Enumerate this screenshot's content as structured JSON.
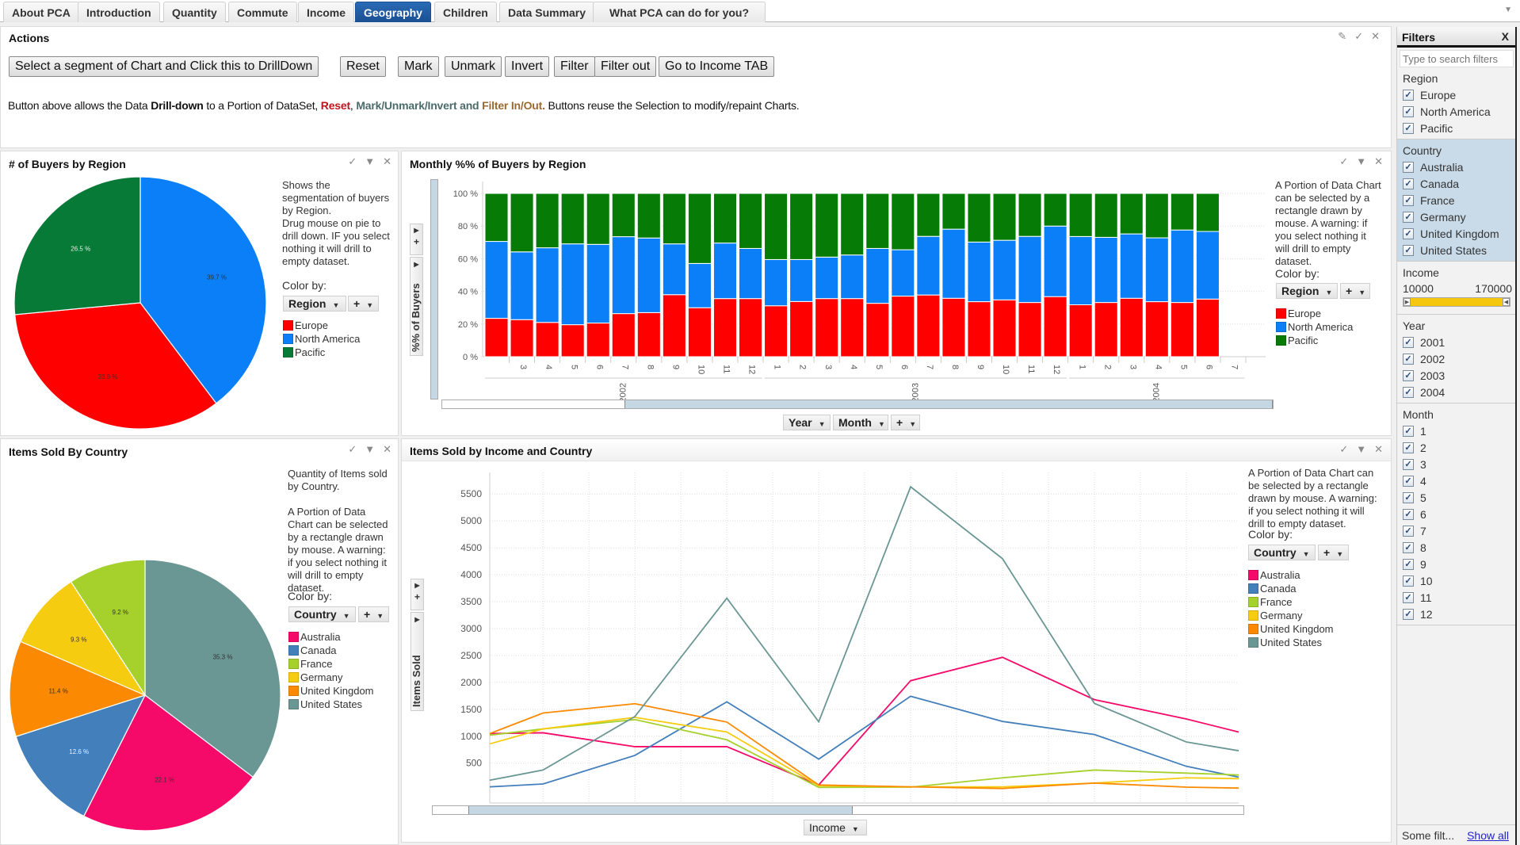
{
  "tabs": [
    {
      "label": "About PCA",
      "active": false
    },
    {
      "label": "Introduction",
      "active": false
    },
    {
      "label": "Quantity",
      "active": false
    },
    {
      "label": "Commute",
      "active": false
    },
    {
      "label": "Income",
      "active": false
    },
    {
      "label": "Geography",
      "active": true
    },
    {
      "label": "Children",
      "active": false
    },
    {
      "label": "Data Summary",
      "active": false
    },
    {
      "label": "What PCA can do for you?",
      "active": false
    }
  ],
  "actions": {
    "title": "Actions",
    "buttons": [
      "Select a segment of Chart and Click this to DrillDown",
      "Reset",
      "Mark",
      "Unmark",
      "Invert",
      "Filter",
      "Filter out",
      "Go to Income TAB"
    ],
    "description": {
      "p1": "Button above allows the Data ",
      "b1": "Drill-down",
      "p2": " to a Portion of DataSet, ",
      "reset": "Reset",
      "p3": ", ",
      "mark": "Mark/Unmark/Invert and",
      "p4": " ",
      "filter": "Filter In/Out.",
      "p5": " Buttons reuse the Selection to modify/repaint Charts."
    }
  },
  "colors": {
    "region": {
      "Europe": "#ff0000",
      "North America": "#0a7ff7",
      "Pacific": "#087a38"
    },
    "country": {
      "Australia": "#f50a6a",
      "Canada": "#437fbb",
      "France": "#a6d12d",
      "Germany": "#f6cc10",
      "United Kingdom": "#fb8a02",
      "United States": "#6a9694"
    },
    "bar_pacific": "#067b06"
  },
  "buyers_panel": {
    "title": "# of Buyers by Region",
    "help": "Shows the\nsegmentation of buyers\nby Region.\nDrug mouse on pie to\ndrill down. IF you select\nnothing it will drill to\nempty dataset.",
    "color_by_label": "Color by:",
    "color_by_value": "Region",
    "plus_label": "+"
  },
  "monthly_panel": {
    "title": "Monthly %% of Buyers by Region",
    "help": "A Portion of Data Chart\ncan be selected by a\nrectangle drawn by\nmouse. A warning: if\nyou select nothing it\nwill drill to empty\ndataset.",
    "color_by_label": "Color by:",
    "color_by_value": "Region",
    "plus_label": "+",
    "axis_ctrl_label": "%% of Buyers",
    "x_buttons": [
      "Year",
      "Month",
      "+"
    ]
  },
  "country_panel": {
    "title": "Items Sold By Country",
    "help": "Quantity of Items sold\nby Country.\n\nA Portion of Data\nChart can be selected\nby a rectangle drawn\nby mouse. A warning:\nif you select nothing it\nwill drill to empty\ndataset.",
    "color_by_label": "Color by:",
    "color_by_value": "Country",
    "plus_label": "+"
  },
  "income_panel": {
    "title": "Items Sold by Income and Country",
    "help": "A Portion of Data Chart can\nbe selected by a rectangle\ndrawn by mouse. A warning:\nif you select nothing it will\ndrill to empty dataset.",
    "color_by_label": "Color by:",
    "color_by_value": "Country",
    "plus_label": "+",
    "axis_ctrl_label": "Items Sold",
    "x_button": "Income"
  },
  "chart_data": [
    {
      "id": "buyers_by_region",
      "type": "pie",
      "title": "# of Buyers by Region",
      "legend_title": "Region",
      "slices": [
        {
          "label": "North America",
          "value": 39.7,
          "display": "39.7 %"
        },
        {
          "label": "Europe",
          "value": 33.8,
          "display": "33.8 %"
        },
        {
          "label": "Pacific",
          "value": 26.5,
          "display": "26.5 %"
        }
      ],
      "legend": [
        "Europe",
        "North America",
        "Pacific"
      ]
    },
    {
      "id": "monthly_buyers_by_region",
      "type": "bar",
      "stacked": true,
      "title": "Monthly %% of Buyers by Region",
      "ylabel": "%% of Buyers",
      "xlabel": "Year / Month",
      "ylim": [
        0,
        100
      ],
      "yticks": [
        "0 %",
        "20 %",
        "40 %",
        "60 %",
        "80 %",
        "100 %"
      ],
      "categories": [
        {
          "year": "2002",
          "month": ""
        },
        {
          "year": "2002",
          "month": "3"
        },
        {
          "year": "2002",
          "month": "4"
        },
        {
          "year": "2002",
          "month": "5"
        },
        {
          "year": "2002",
          "month": "6"
        },
        {
          "year": "2002",
          "month": "7"
        },
        {
          "year": "2002",
          "month": "8"
        },
        {
          "year": "2002",
          "month": "9"
        },
        {
          "year": "2002",
          "month": "10"
        },
        {
          "year": "2002",
          "month": "11"
        },
        {
          "year": "2002",
          "month": "12"
        },
        {
          "year": "2003",
          "month": "1"
        },
        {
          "year": "2003",
          "month": "2"
        },
        {
          "year": "2003",
          "month": "3"
        },
        {
          "year": "2003",
          "month": "4"
        },
        {
          "year": "2003",
          "month": "5"
        },
        {
          "year": "2003",
          "month": "6"
        },
        {
          "year": "2003",
          "month": "7"
        },
        {
          "year": "2003",
          "month": "8"
        },
        {
          "year": "2003",
          "month": "9"
        },
        {
          "year": "2003",
          "month": "10"
        },
        {
          "year": "2003",
          "month": "11"
        },
        {
          "year": "2003",
          "month": "12"
        },
        {
          "year": "2004",
          "month": "1"
        },
        {
          "year": "2004",
          "month": "2"
        },
        {
          "year": "2004",
          "month": "3"
        },
        {
          "year": "2004",
          "month": "4"
        },
        {
          "year": "2004",
          "month": "5"
        },
        {
          "year": "2004",
          "month": "6"
        },
        {
          "year": "2004",
          "month": "7"
        }
      ],
      "year_labels": [
        "2002",
        "2003",
        "2004"
      ],
      "series": [
        {
          "name": "Europe",
          "values": [
            23.5,
            22.7,
            21.0,
            19.6,
            20.6,
            26.4,
            27.0,
            38.0,
            30.0,
            35.6,
            35.6,
            31.2,
            33.8,
            35.6,
            35.6,
            32.7,
            37.1,
            37.8,
            35.8,
            33.7,
            34.8,
            33.2,
            36.8,
            31.8,
            33.2,
            35.8,
            33.7,
            33.2,
            35.3,
            null
          ]
        },
        {
          "name": "North America",
          "values": [
            47.1,
            41.5,
            45.7,
            49.5,
            48.2,
            47.1,
            45.7,
            31.1,
            27.1,
            34.0,
            30.7,
            28.3,
            25.7,
            25.4,
            26.7,
            33.6,
            28.4,
            35.9,
            42.3,
            36.5,
            36.5,
            40.5,
            43.2,
            41.8,
            39.9,
            39.4,
            39.1,
            44.4,
            41.4,
            null
          ]
        },
        {
          "name": "Pacific",
          "values": [
            29.4,
            35.8,
            33.3,
            30.9,
            31.2,
            26.5,
            27.3,
            30.9,
            42.9,
            30.4,
            33.7,
            40.5,
            40.5,
            39.0,
            37.7,
            33.7,
            34.5,
            26.3,
            21.9,
            29.8,
            28.7,
            26.3,
            20.0,
            26.4,
            26.9,
            24.8,
            27.2,
            22.4,
            23.3,
            null
          ]
        }
      ],
      "legend": [
        "Europe",
        "North America",
        "Pacific"
      ],
      "grid": true
    },
    {
      "id": "items_sold_by_country",
      "type": "pie",
      "title": "Items Sold By Country",
      "legend_title": "Country",
      "slices": [
        {
          "label": "United States",
          "value": 35.3,
          "display": "35.3 %"
        },
        {
          "label": "Australia",
          "value": 22.1,
          "display": "22.1 %"
        },
        {
          "label": "Canada",
          "value": 12.6,
          "display": "12.6 %"
        },
        {
          "label": "United Kingdom",
          "value": 11.4,
          "display": "11.4 %"
        },
        {
          "label": "Germany",
          "value": 9.3,
          "display": "9.3 %"
        },
        {
          "label": "France",
          "value": 9.2,
          "display": "9.2 %"
        }
      ],
      "legend": [
        "Australia",
        "Canada",
        "France",
        "Germany",
        "United Kingdom",
        "United States"
      ]
    },
    {
      "id": "items_sold_by_income_and_country",
      "type": "line",
      "title": "Items Sold by Income and Country",
      "xlabel": "Income",
      "ylabel": "Items Sold",
      "xlim": [
        14200,
        95700
      ],
      "ylim": [
        -240,
        5900
      ],
      "xticks": [
        20000,
        25000,
        30000,
        35000,
        40000,
        45000,
        50000,
        55000,
        60000,
        65000,
        70000,
        75000,
        80000,
        85000,
        90000
      ],
      "yticks": [
        500,
        1000,
        1500,
        2000,
        2500,
        3000,
        3500,
        4000,
        4500,
        5000,
        5500
      ],
      "x": [
        14200,
        20000,
        30000,
        40000,
        50000,
        60000,
        70000,
        80000,
        90000,
        95700
      ],
      "series": [
        {
          "name": "Australia",
          "values": [
            1049,
            1064,
            806,
            806,
            95,
            2032,
            2466,
            1680,
            1321,
            1078
          ]
        },
        {
          "name": "Canada",
          "values": [
            60,
            113,
            644,
            1639,
            575,
            1743,
            1275,
            1032,
            442,
            240
          ]
        },
        {
          "name": "France",
          "values": [
            1020,
            1136,
            1309,
            934,
            50,
            55,
            228,
            372,
            315,
            280
          ]
        },
        {
          "name": "Germany",
          "values": [
            858,
            1136,
            1350,
            1078,
            80,
            60,
            60,
            130,
            228,
            212
          ]
        },
        {
          "name": "United Kingdom",
          "values": [
            1049,
            1431,
            1604,
            1263,
            95,
            60,
            30,
            130,
            55,
            37
          ]
        },
        {
          "name": "United States",
          "values": [
            183,
            372,
            1367,
            3564,
            1269,
            5633,
            4298,
            1610,
            893,
            731
          ]
        }
      ],
      "legend": [
        "Australia",
        "Canada",
        "France",
        "Germany",
        "United Kingdom",
        "United States"
      ],
      "grid": true
    }
  ],
  "filters": {
    "title": "Filters",
    "close": "X",
    "search_placeholder": "Type to search filters",
    "groups": [
      {
        "title": "Region",
        "items": [
          "Europe",
          "North America",
          "Pacific"
        ]
      },
      {
        "title": "Country",
        "items": [
          "Australia",
          "Canada",
          "France",
          "Germany",
          "United Kingdom",
          "United States"
        ],
        "highlight": true
      },
      {
        "title": "Income",
        "range": {
          "min": "10000",
          "max": "170000"
        }
      },
      {
        "title": "Year",
        "items": [
          "2001",
          "2002",
          "2003",
          "2004"
        ]
      },
      {
        "title": "Month",
        "items": [
          "1",
          "2",
          "3",
          "4",
          "5",
          "6",
          "7",
          "8",
          "9",
          "10",
          "11",
          "12"
        ]
      }
    ],
    "footer_status": "Some filt...",
    "show_all": "Show all"
  }
}
